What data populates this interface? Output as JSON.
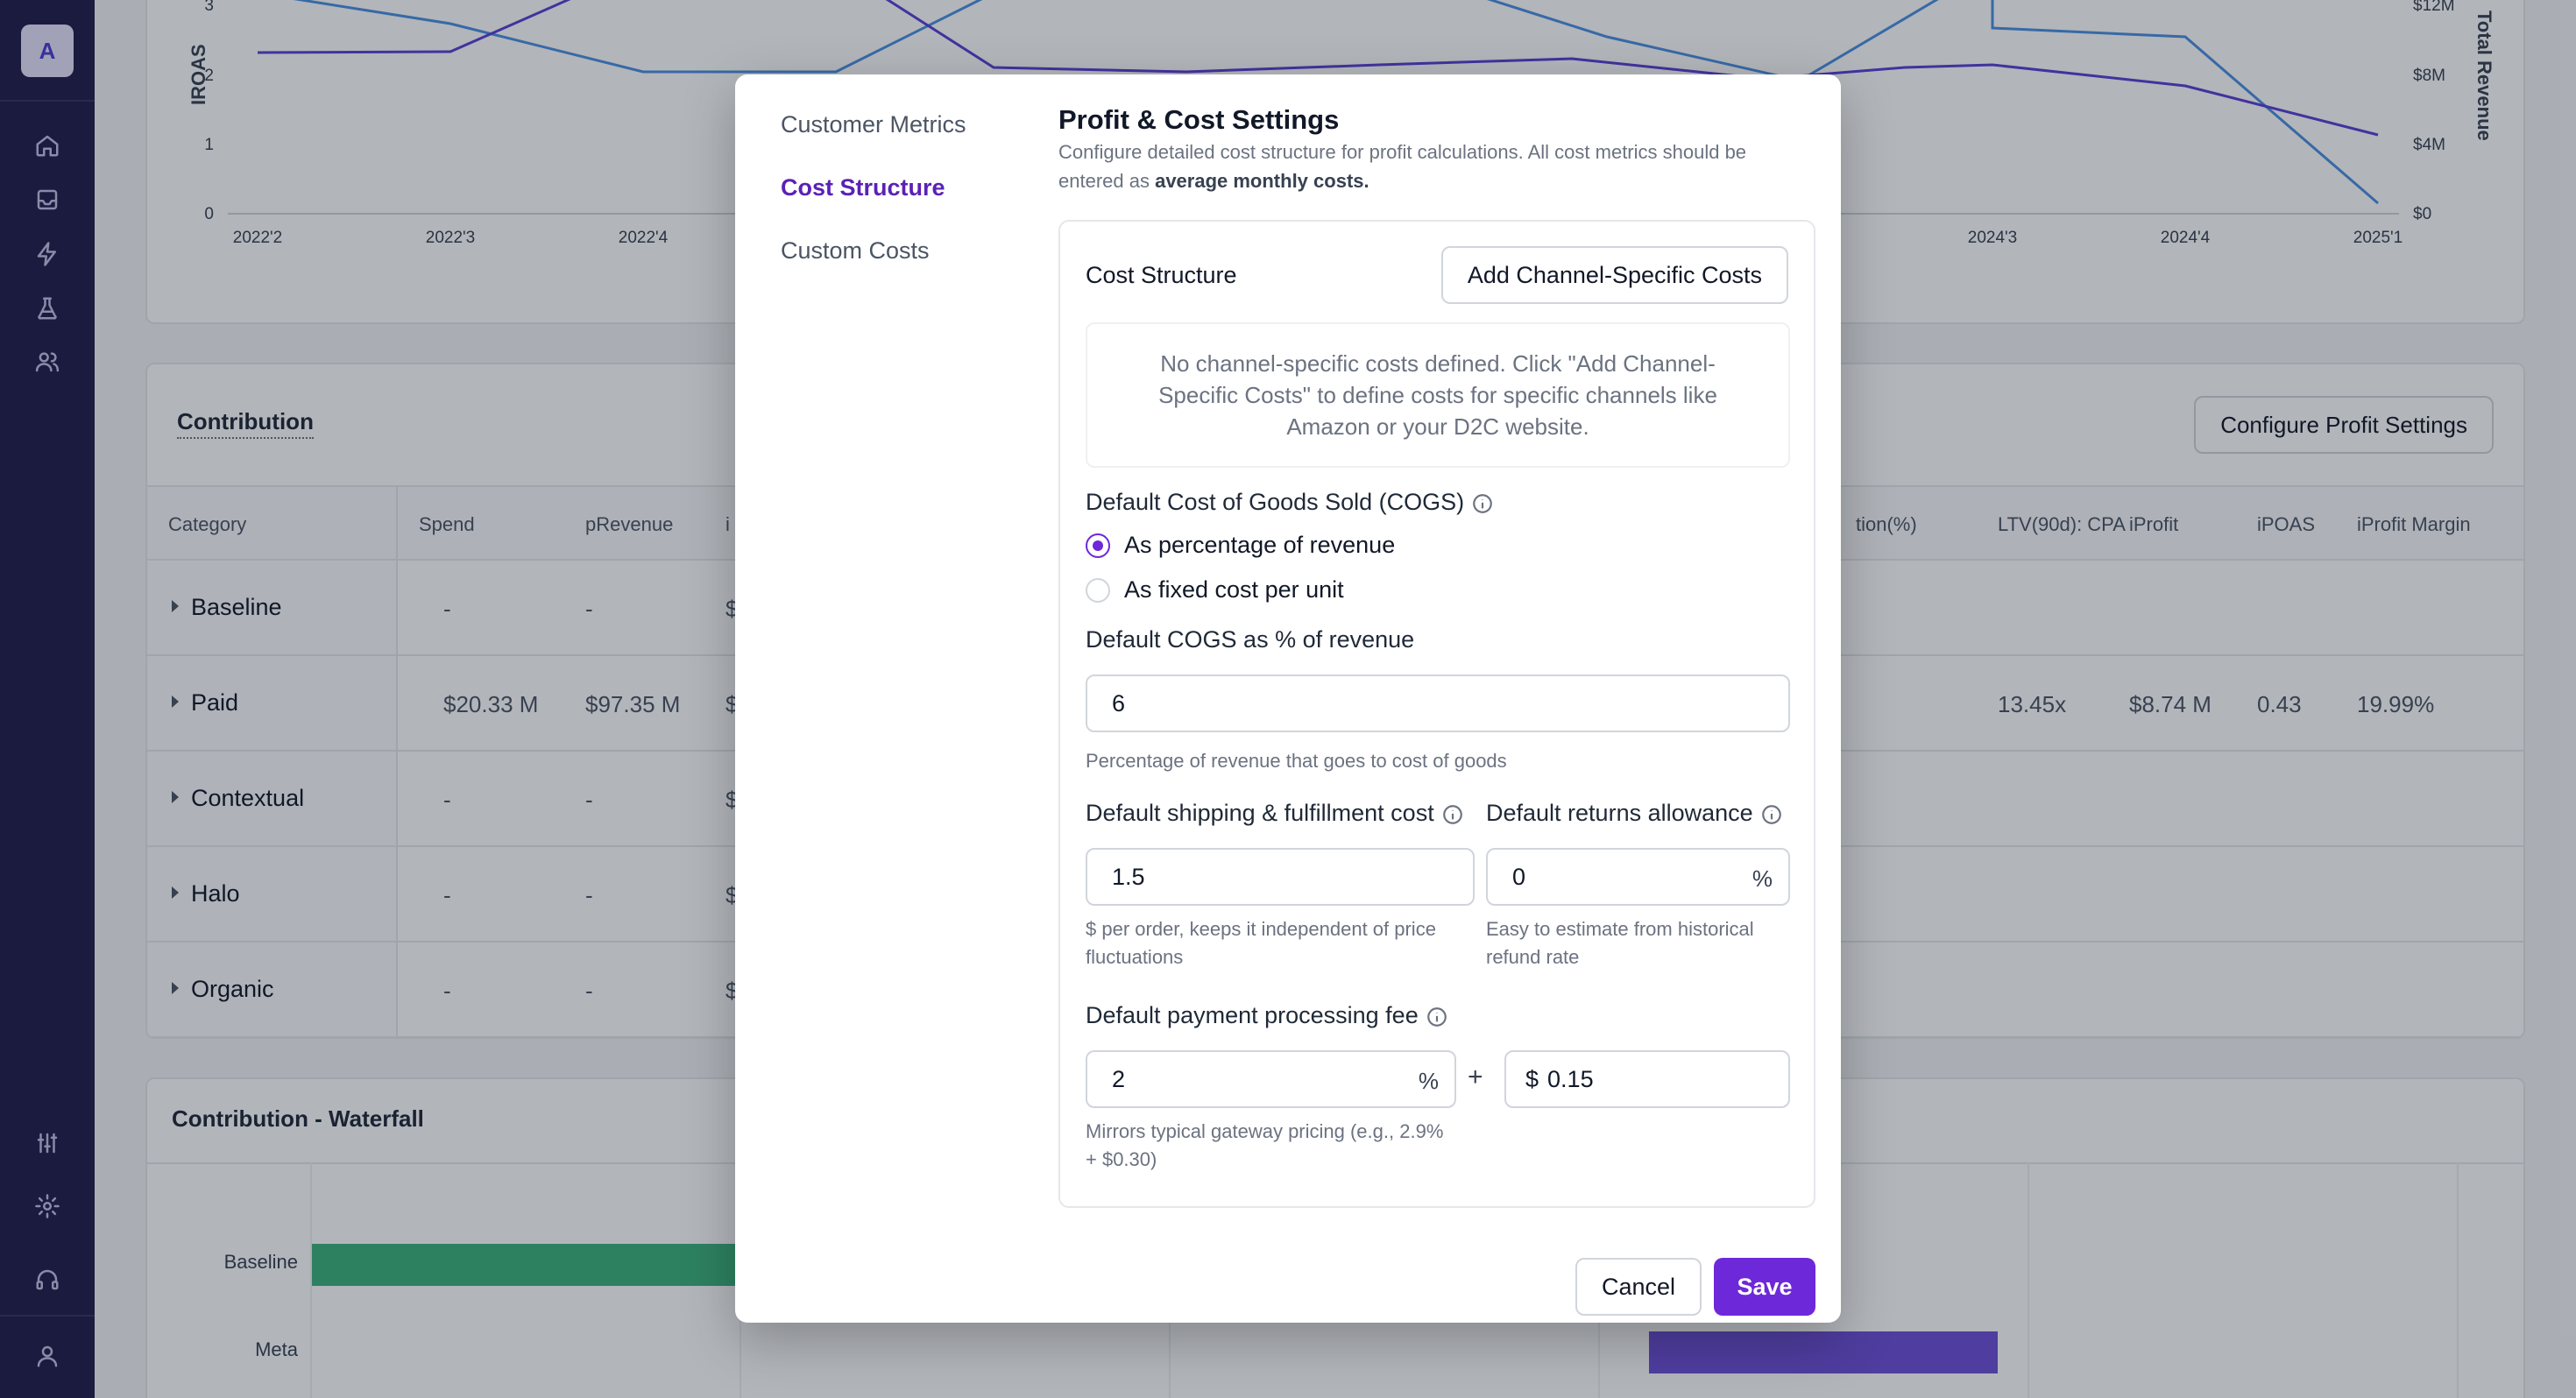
{
  "sidebar": {
    "logo_letter": "A",
    "top_icons": [
      "home-icon",
      "inbox-icon",
      "bolt-icon",
      "flask-icon",
      "users-icon"
    ],
    "bottom_icons": [
      "sliders-icon",
      "gear-icon",
      "headset-icon",
      "user-icon"
    ]
  },
  "top_chart": {
    "left_axis_title": "IROAS",
    "right_axis_title": "Total Revenue",
    "left_ticks": [
      "3",
      "2",
      "1",
      "0"
    ],
    "right_ticks": [
      "$12M",
      "$8M",
      "$4M",
      "$0"
    ],
    "x_ticks": [
      "2022'2",
      "2022'3",
      "2022'4",
      "2024'3",
      "2024'4",
      "2025'1"
    ],
    "colors": {
      "iroas": "#5b3fd6",
      "revenue": "#4a90e2"
    }
  },
  "contribution": {
    "title": "Contribution",
    "configure_button": "Configure Profit Settings",
    "columns_left": [
      "Category",
      "Spend",
      "pRevenue",
      "i"
    ],
    "columns_right": [
      "tion(%)",
      "LTV(90d): CPA",
      "iProfit",
      "iPOAS",
      "iProfit Margin"
    ],
    "rows": [
      {
        "category": "Baseline",
        "spend": "-",
        "prevenue": "-",
        "partial": "$",
        "ltv": "",
        "iprofit": "",
        "ipoas": "",
        "margin": ""
      },
      {
        "category": "Paid",
        "spend": "$20.33 M",
        "prevenue": "$97.35 M",
        "partial": "$",
        "ltv": "13.45x",
        "iprofit": "$8.74 M",
        "ipoas": "0.43",
        "margin": "19.99%"
      },
      {
        "category": "Contextual",
        "spend": "-",
        "prevenue": "-",
        "partial": "$",
        "ltv": "",
        "iprofit": "",
        "ipoas": "",
        "margin": ""
      },
      {
        "category": "Halo",
        "spend": "-",
        "prevenue": "-",
        "partial": "$",
        "ltv": "",
        "iprofit": "",
        "ipoas": "",
        "margin": ""
      },
      {
        "category": "Organic",
        "spend": "-",
        "prevenue": "-",
        "partial": "$",
        "ltv": "",
        "iprofit": "",
        "ipoas": "",
        "margin": ""
      }
    ]
  },
  "waterfall": {
    "title": "Contribution - Waterfall",
    "labels": [
      "Baseline",
      "Meta"
    ],
    "colors": {
      "baseline": "#3cb37c",
      "meta": "#6d4ed8"
    }
  },
  "modal": {
    "nav": [
      "Customer Metrics",
      "Cost Structure",
      "Custom Costs"
    ],
    "active_nav": "Cost Structure",
    "title": "Profit & Cost Settings",
    "description_prefix": "Configure detailed cost structure for profit calculations. All cost metrics should be entered as ",
    "description_bold": "average monthly costs.",
    "cost_structure_label": "Cost Structure",
    "add_button": "Add Channel-Specific Costs",
    "empty_message": "No channel-specific costs defined. Click \"Add Channel-Specific Costs\" to define costs for specific channels like Amazon or your D2C website.",
    "cogs_label": "Default Cost of Goods Sold (COGS)",
    "radio_percent": "As percentage of revenue",
    "radio_fixed": "As fixed cost per unit",
    "cogs_pct_label": "Default COGS as % of revenue",
    "cogs_value": "6",
    "cogs_hint": "Percentage of revenue that goes to cost of goods",
    "shipping_label": "Default shipping & fulfillment cost",
    "shipping_value": "1.5",
    "shipping_hint": "$ per order, keeps it independent of price fluctuations",
    "returns_label": "Default returns allowance",
    "returns_value": "0",
    "returns_suffix": "%",
    "returns_hint": "Easy to estimate from historical refund rate",
    "payment_label": "Default payment processing fee",
    "payment_pct_value": "2",
    "payment_pct_suffix": "%",
    "plus_sign": "+",
    "payment_fixed_prefix": "$",
    "payment_fixed_value": "0.15",
    "payment_hint": "Mirrors typical gateway pricing (e.g., 2.9% + $0.30)",
    "cancel": "Cancel",
    "save": "Save",
    "accent": "#6d28d9"
  }
}
